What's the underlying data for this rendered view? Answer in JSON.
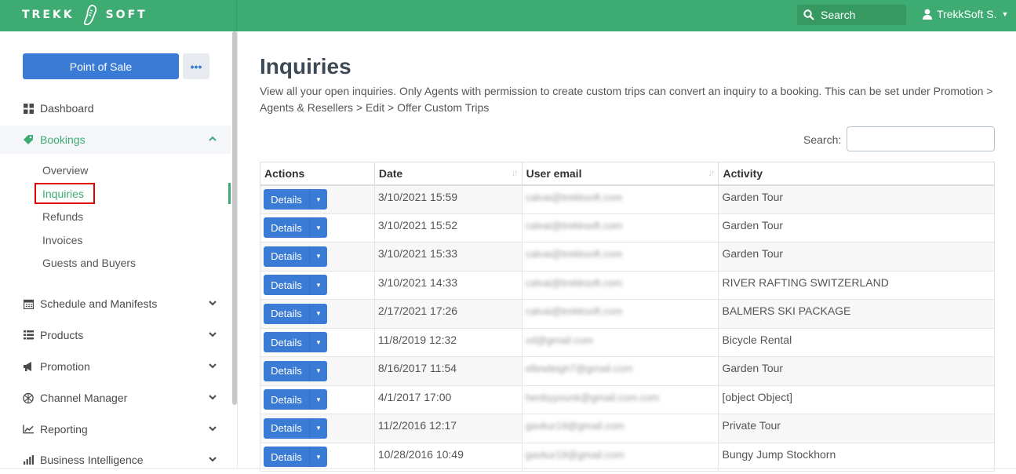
{
  "header": {
    "logo_left": "TREKK",
    "logo_right": "SOFT",
    "search_label": "Search",
    "user_name": "TrekkSoft S."
  },
  "sidebar": {
    "pos_button": "Point of Sale",
    "more_button": "•••",
    "items": [
      {
        "label": "Dashboard",
        "icon": "dashboard-icon"
      },
      {
        "label": "Bookings",
        "icon": "tag-icon"
      },
      {
        "label": "Schedule and Manifests",
        "icon": "calendar-icon"
      },
      {
        "label": "Products",
        "icon": "list-icon"
      },
      {
        "label": "Promotion",
        "icon": "megaphone-icon"
      },
      {
        "label": "Channel Manager",
        "icon": "globe-icon"
      },
      {
        "label": "Reporting",
        "icon": "line-chart-icon"
      },
      {
        "label": "Business Intelligence",
        "icon": "bar-chart-icon"
      }
    ],
    "bookings_sub": [
      "Overview",
      "Inquiries",
      "Refunds",
      "Invoices",
      "Guests and Buyers"
    ]
  },
  "main": {
    "title": "Inquiries",
    "description": "View all your open inquiries. Only Agents with permission to create custom trips can convert an inquiry to a booking. This can be set under Promotion > Agents & Resellers > Edit > Offer Custom Trips",
    "search_label": "Search:",
    "table": {
      "headers": [
        "Actions",
        "Date",
        "User email",
        "Activity"
      ],
      "details_label": "Details",
      "rows": [
        {
          "date": "3/10/2021 15:59",
          "email": "calvai@trekksoft.com",
          "activity": "Garden Tour"
        },
        {
          "date": "3/10/2021 15:52",
          "email": "calvai@trekksoft.com",
          "activity": "Garden Tour"
        },
        {
          "date": "3/10/2021 15:33",
          "email": "calvai@trekksoft.com",
          "activity": "Garden Tour"
        },
        {
          "date": "3/10/2021 14:33",
          "email": "calvai@trekksoft.com",
          "activity": "RIVER RAFTING SWITZERLAND"
        },
        {
          "date": "2/17/2021 17:26",
          "email": "calvai@trekksoft.com",
          "activity": "BALMERS SKI PACKAGE"
        },
        {
          "date": "11/8/2019 12:32",
          "email": "xd@gmail.com",
          "activity": "Bicycle Rental"
        },
        {
          "date": "8/16/2017 11:54",
          "email": "ellewleigh7@gmail.com",
          "activity": "Garden Tour"
        },
        {
          "date": "4/1/2017 17:00",
          "email": "henbyyounk@gmail.com.com",
          "activity": "[object Object]"
        },
        {
          "date": "11/2/2016 12:17",
          "email": "gavkur19@gmail.com",
          "activity": "Private Tour"
        },
        {
          "date": "10/28/2016 10:49",
          "email": "gavkur19@gmail.com",
          "activity": "Bungy Jump Stockhorn"
        }
      ]
    }
  },
  "colors": {
    "brand_green": "#3dab72",
    "button_blue": "#3a7bd5",
    "highlight_red": "#e00000"
  }
}
